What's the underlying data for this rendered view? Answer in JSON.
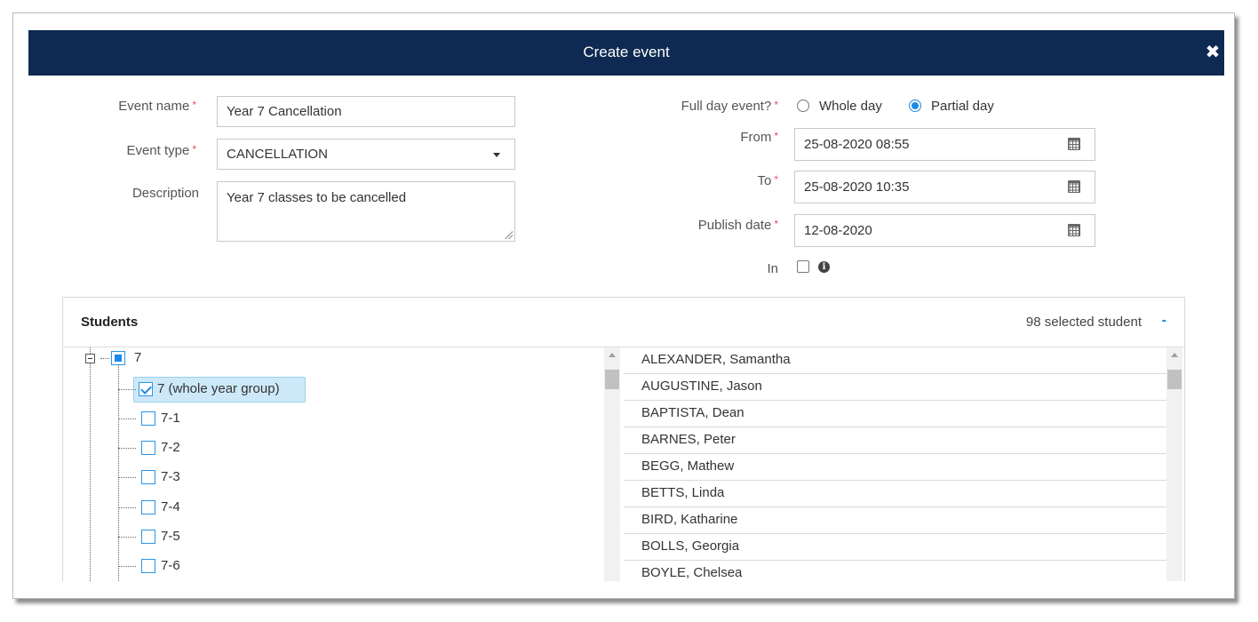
{
  "modal": {
    "title": "Create event"
  },
  "form": {
    "event_name": {
      "label": "Event name",
      "value": "Year 7 Cancellation"
    },
    "event_type": {
      "label": "Event type",
      "value": "CANCELLATION"
    },
    "description": {
      "label": "Description",
      "value": "Year 7 classes to be cancelled"
    },
    "full_day": {
      "label": "Full day event?",
      "options": [
        "Whole day",
        "Partial day"
      ],
      "selected": "Partial day"
    },
    "from": {
      "label": "From",
      "value": "25-08-2020 08:55"
    },
    "to": {
      "label": "To",
      "value": "25-08-2020 10:35"
    },
    "publish_date": {
      "label": "Publish date",
      "value": "12-08-2020"
    },
    "in": {
      "label": "In",
      "checked": false
    },
    "required_mark": "*"
  },
  "students": {
    "title": "Students",
    "selected_count": "98 selected student",
    "collapse_symbol": "-",
    "tree": [
      {
        "label": "7",
        "state": "partial",
        "expander": "minus"
      },
      {
        "label": "7 (whole year group)",
        "state": "checked",
        "highlighted": true
      },
      {
        "label": "7-1",
        "state": "unchecked"
      },
      {
        "label": "7-2",
        "state": "unchecked"
      },
      {
        "label": "7-3",
        "state": "unchecked"
      },
      {
        "label": "7-4",
        "state": "unchecked"
      },
      {
        "label": "7-5",
        "state": "unchecked"
      },
      {
        "label": "7-6",
        "state": "unchecked"
      }
    ],
    "list": [
      "ALEXANDER, Samantha",
      "AUGUSTINE, Jason",
      "BAPTISTA, Dean",
      "BARNES, Peter",
      "BEGG, Mathew",
      "BETTS, Linda",
      "BIRD, Katharine",
      "BOLLS, Georgia",
      "BOYLE, Chelsea"
    ]
  },
  "icons": {
    "close": "close-icon",
    "calendar": "calendar-icon",
    "info": "info-icon",
    "dropdown": "caret-down-icon"
  },
  "colors": {
    "header_bg": "#0e2a52",
    "accent": "#1e88e5",
    "required": "#e2505a",
    "selection_bg": "#cde9f9"
  }
}
